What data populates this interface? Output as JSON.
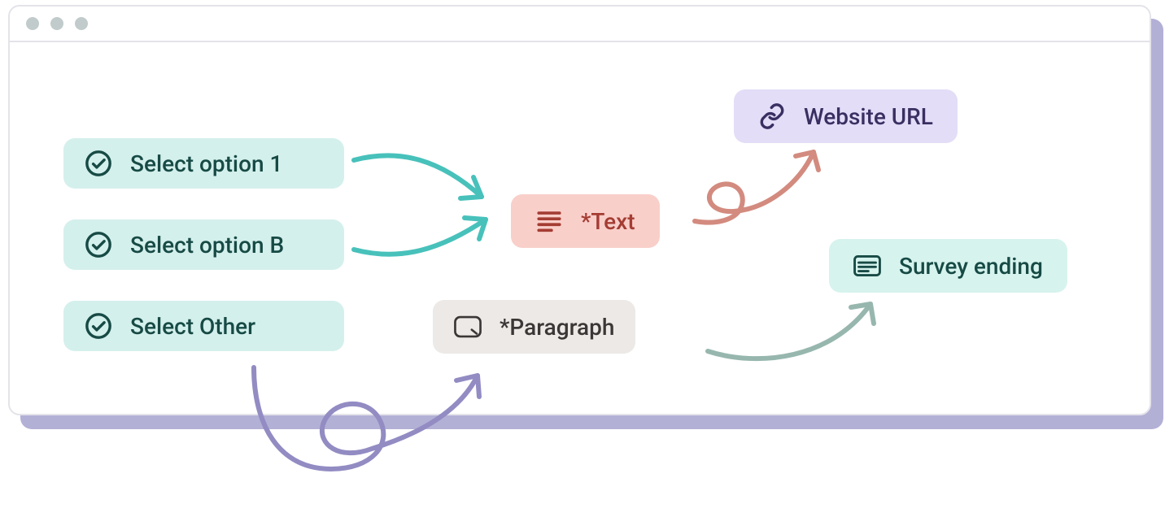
{
  "options": [
    {
      "label": "Select option 1"
    },
    {
      "label": "Select option B"
    },
    {
      "label": "Select Other"
    }
  ],
  "text_node": {
    "label": "*Text"
  },
  "paragraph_node": {
    "label": "*Paragraph"
  },
  "url_node": {
    "label": "Website URL"
  },
  "ending_node": {
    "label": "Survey ending"
  },
  "colors": {
    "option_bg": "#d4f0ec",
    "text_bg": "#f9cfca",
    "para_bg": "#ece9e7",
    "url_bg": "#e3ddf7",
    "end_bg": "#d7f3ee",
    "arrow_teal": "#48c1bb",
    "arrow_purple": "#928cc3",
    "arrow_salmon": "#d38b7f",
    "arrow_sage": "#97b7ae"
  }
}
